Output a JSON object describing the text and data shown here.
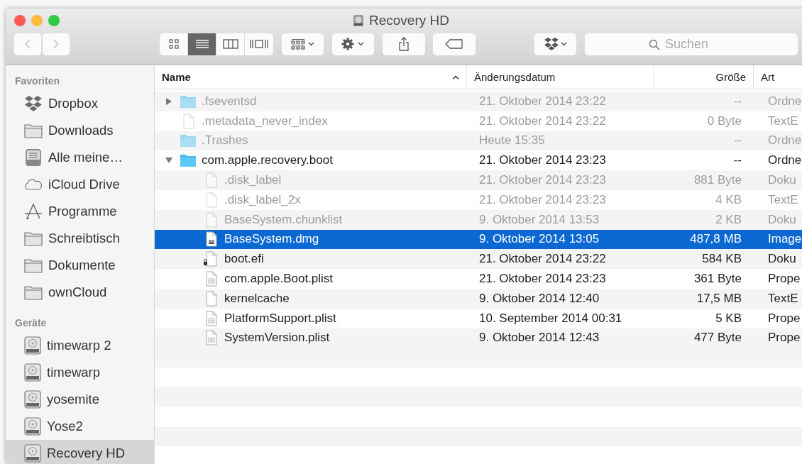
{
  "window": {
    "title": "Recovery HD"
  },
  "toolbar": {
    "view_modes": [
      {
        "kind": "icons",
        "selected": false
      },
      {
        "kind": "list",
        "selected": true
      },
      {
        "kind": "columns",
        "selected": false
      },
      {
        "kind": "coverflow",
        "selected": false
      }
    ],
    "search": {
      "placeholder": "Suchen"
    }
  },
  "sidebar": {
    "sections": [
      {
        "title": "Favoriten",
        "items": [
          {
            "label": "Dropbox",
            "kind": "dropbox",
            "selected": false
          },
          {
            "label": "Downloads",
            "kind": "folder",
            "selected": false
          },
          {
            "label": "Alle meine…",
            "kind": "tray",
            "selected": false
          },
          {
            "label": "iCloud Drive",
            "kind": "cloud",
            "selected": false
          },
          {
            "label": "Programme",
            "kind": "apps",
            "selected": false
          },
          {
            "label": "Schreibtisch",
            "kind": "folder",
            "selected": false
          },
          {
            "label": "Dokumente",
            "kind": "folder",
            "selected": false
          },
          {
            "label": "ownCloud",
            "kind": "folder",
            "selected": false
          }
        ]
      },
      {
        "title": "Geräte",
        "items": [
          {
            "label": "timewarp 2",
            "kind": "disk",
            "selected": false
          },
          {
            "label": "timewarp",
            "kind": "disk",
            "selected": false
          },
          {
            "label": "yosemite",
            "kind": "disk",
            "selected": false
          },
          {
            "label": "Yose2",
            "kind": "disk",
            "selected": false
          },
          {
            "label": "Recovery HD",
            "kind": "disk",
            "selected": true
          }
        ]
      }
    ]
  },
  "table": {
    "columns": [
      {
        "label": "Name",
        "sorted": true
      },
      {
        "label": "Änderungsdatum",
        "sorted": false
      },
      {
        "label": "Größe",
        "sorted": false
      },
      {
        "label": "Art",
        "sorted": false
      }
    ],
    "rows": [
      {
        "name": ".fseventsd",
        "kind": "folder",
        "date": "21. Oktober 2014 23:22",
        "size": "--",
        "type": "Ordne",
        "dimmed": true,
        "expanded": false,
        "selected": false,
        "children": []
      },
      {
        "name": ".metadata_never_index",
        "kind": "file",
        "date": "21. Oktober 2014 23:22",
        "size": "0 Byte",
        "type": "TextE",
        "dimmed": true,
        "selected": false
      },
      {
        "name": ".Trashes",
        "kind": "folder",
        "date": "Heute 15:35",
        "size": "--",
        "type": "Ordne",
        "dimmed": true,
        "selected": false
      },
      {
        "name": "com.apple.recovery.boot",
        "kind": "folder",
        "date": "21. Oktober 2014 23:23",
        "size": "--",
        "type": "Ordne",
        "dimmed": false,
        "expanded": true,
        "selected": false,
        "children": [
          {
            "name": ".disk_label",
            "kind": "file",
            "date": "21. Oktober 2014 23:23",
            "size": "881 Byte",
            "type": "Doku",
            "dimmed": true,
            "selected": false
          },
          {
            "name": ".disk_label_2x",
            "kind": "file",
            "date": "21. Oktober 2014 23:23",
            "size": "4 KB",
            "type": "TextE",
            "dimmed": true,
            "selected": false
          },
          {
            "name": "BaseSystem.chunklist",
            "kind": "file",
            "date": "9. Oktober 2014 13:53",
            "size": "2 KB",
            "type": "Doku",
            "dimmed": true,
            "selected": false
          },
          {
            "name": "BaseSystem.dmg",
            "kind": "image",
            "date": "9. Oktober 2014 13:05",
            "size": "487,8 MB",
            "type": "Image",
            "dimmed": false,
            "selected": true
          },
          {
            "name": "boot.efi",
            "kind": "locked",
            "date": "21. Oktober 2014 23:22",
            "size": "584 KB",
            "type": "Doku",
            "dimmed": false,
            "selected": false
          },
          {
            "name": "com.apple.Boot.plist",
            "kind": "plist",
            "date": "21. Oktober 2014 23:23",
            "size": "361 Byte",
            "type": "Prope",
            "dimmed": false,
            "selected": false
          },
          {
            "name": "kernelcache",
            "kind": "file",
            "date": "9. Oktober 2014 12:40",
            "size": "17,5 MB",
            "type": "TextE",
            "dimmed": false,
            "selected": false
          },
          {
            "name": "PlatformSupport.plist",
            "kind": "plist",
            "date": "10. September 2014 00:31",
            "size": "5 KB",
            "type": "Prope",
            "dimmed": false,
            "selected": false
          },
          {
            "name": "SystemVersion.plist",
            "kind": "plist",
            "date": "9. Oktober 2014 12:43",
            "size": "477 Byte",
            "type": "Prope",
            "dimmed": false,
            "selected": false
          }
        ]
      }
    ]
  }
}
